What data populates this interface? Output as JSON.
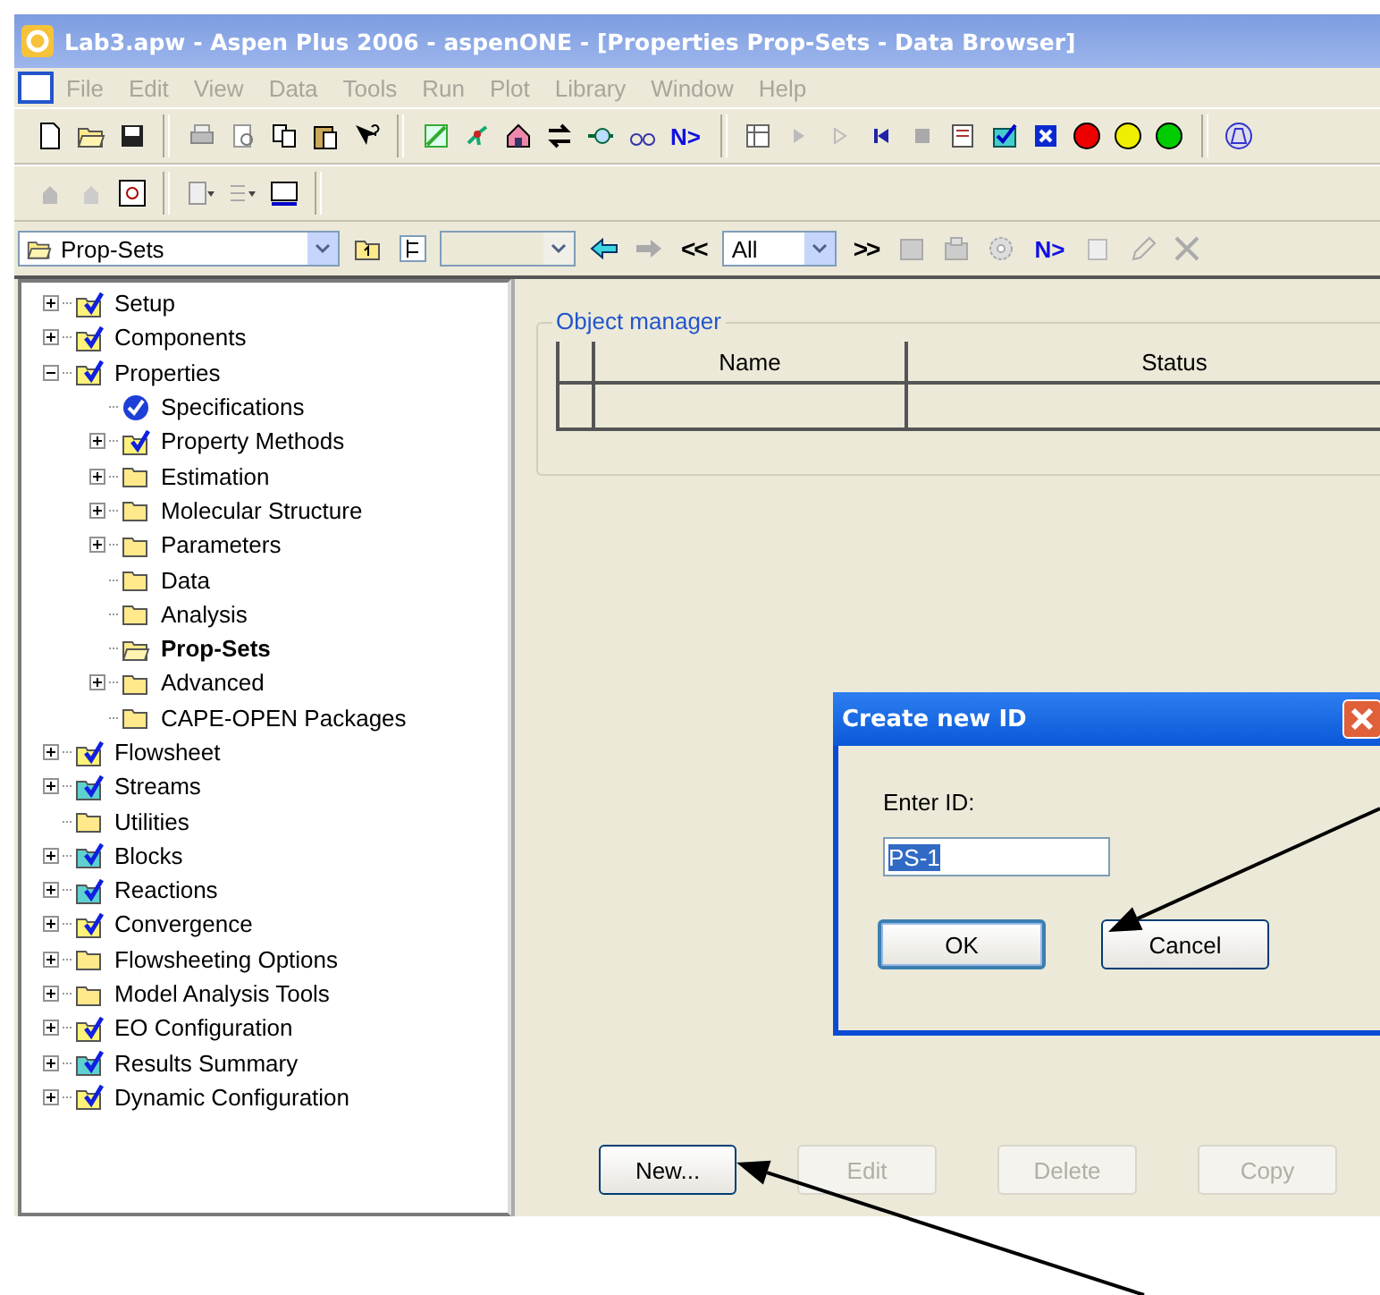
{
  "window": {
    "title": "Lab3.apw - Aspen Plus 2006 - aspenONE - [Properties Prop-Sets - Data Browser]",
    "active": false
  },
  "menu": [
    {
      "label": "File",
      "disabled": true
    },
    {
      "label": "Edit",
      "disabled": true
    },
    {
      "label": "View",
      "disabled": true
    },
    {
      "label": "Data",
      "disabled": true
    },
    {
      "label": "Tools",
      "disabled": true
    },
    {
      "label": "Run",
      "disabled": true
    },
    {
      "label": "Plot",
      "disabled": true
    },
    {
      "label": "Library",
      "disabled": true
    },
    {
      "label": "Window",
      "disabled": true
    },
    {
      "label": "Help",
      "disabled": true
    }
  ],
  "toolbar": {
    "next": "N>"
  },
  "navigator": {
    "folder": "Prop-Sets",
    "previous": "<<",
    "filter": "All",
    "forward": ">>",
    "next": "N>"
  },
  "tree": [
    {
      "label": "Setup",
      "kind": "checked-folder",
      "expanded": false,
      "selected": false
    },
    {
      "label": "Components",
      "kind": "checked-folder",
      "expanded": false,
      "selected": false
    },
    {
      "label": "Properties",
      "kind": "checked-folder",
      "expanded": true,
      "selected": false,
      "children": [
        {
          "label": "Specifications",
          "kind": "check-circle",
          "selected": false
        },
        {
          "label": "Property Methods",
          "kind": "checked-folder",
          "expanded": false,
          "selected": false
        },
        {
          "label": "Estimation",
          "kind": "folder",
          "expanded": false,
          "selected": false
        },
        {
          "label": "Molecular Structure",
          "kind": "folder",
          "expanded": false,
          "selected": false
        },
        {
          "label": "Parameters",
          "kind": "folder",
          "expanded": false,
          "selected": false
        },
        {
          "label": "Data",
          "kind": "folder",
          "selected": false
        },
        {
          "label": "Analysis",
          "kind": "folder",
          "selected": false
        },
        {
          "label": "Prop-Sets",
          "kind": "open-folder",
          "selected": true
        },
        {
          "label": "Advanced",
          "kind": "folder",
          "expanded": false,
          "selected": false
        },
        {
          "label": "CAPE-OPEN Packages",
          "kind": "folder",
          "selected": false
        }
      ]
    },
    {
      "label": "Flowsheet",
      "kind": "checked-folder",
      "expanded": false,
      "selected": false
    },
    {
      "label": "Streams",
      "kind": "checked-teal-folder",
      "expanded": false,
      "selected": false
    },
    {
      "label": "Utilities",
      "kind": "folder",
      "selected": false
    },
    {
      "label": "Blocks",
      "kind": "checked-teal-folder",
      "expanded": false,
      "selected": false
    },
    {
      "label": "Reactions",
      "kind": "checked-teal-folder",
      "expanded": false,
      "selected": false
    },
    {
      "label": "Convergence",
      "kind": "checked-folder",
      "expanded": false,
      "selected": false
    },
    {
      "label": "Flowsheeting Options",
      "kind": "folder",
      "expanded": false,
      "selected": false
    },
    {
      "label": "Model Analysis Tools",
      "kind": "folder",
      "expanded": false,
      "selected": false
    },
    {
      "label": "EO Configuration",
      "kind": "checked-folder",
      "expanded": false,
      "selected": false
    },
    {
      "label": "Results Summary",
      "kind": "checked-teal-folder",
      "expanded": false,
      "selected": false
    },
    {
      "label": "Dynamic Configuration",
      "kind": "checked-folder",
      "expanded": false,
      "selected": false
    }
  ],
  "object_manager": {
    "title": "Object manager",
    "columns": [
      "Name",
      "Status"
    ]
  },
  "buttons": [
    {
      "label": "New...",
      "disabled": false
    },
    {
      "label": "Edit",
      "disabled": true
    },
    {
      "label": "Delete",
      "disabled": true
    },
    {
      "label": "Copy",
      "disabled": true
    }
  ],
  "dialog": {
    "title": "Create new ID",
    "prompt": "Enter ID:",
    "value": "PS-1",
    "buttons": [
      {
        "label": "OK",
        "default": true
      },
      {
        "label": "Cancel",
        "default": false
      }
    ]
  }
}
